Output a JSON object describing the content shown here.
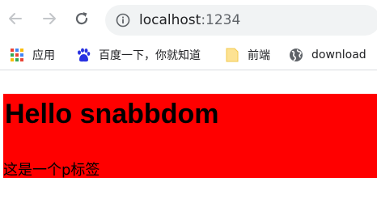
{
  "browser": {
    "url_host": "localhost",
    "url_port": ":1234",
    "icons": {
      "back": "arrow-left-icon",
      "forward": "arrow-right-icon",
      "reload": "reload-icon",
      "info": "info-icon"
    }
  },
  "bookmarks": [
    {
      "label": "应用",
      "icon": "apps-grid-icon"
    },
    {
      "label": "百度一下，你就知道",
      "icon": "baidu-paw-icon"
    },
    {
      "label": "前端",
      "icon": "folder-icon"
    },
    {
      "label": "download",
      "icon": "globe-icon"
    }
  ],
  "page": {
    "background_color": "#ff0000",
    "heading": "Hello snabbdom",
    "paragraph": "这是一个p标签"
  }
}
